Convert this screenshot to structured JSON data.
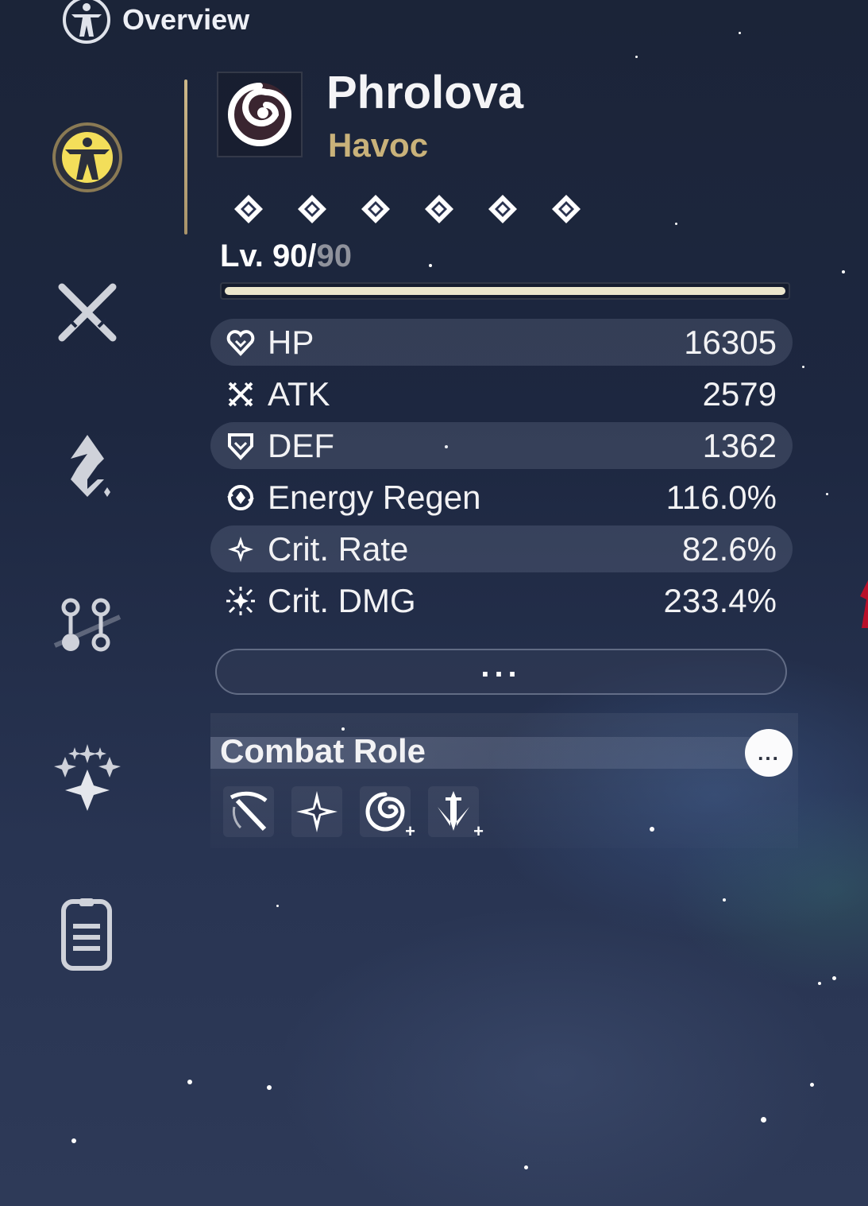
{
  "header": {
    "title": "Overview",
    "icon": "vitruvian-man-icon"
  },
  "sidebar": {
    "items": [
      {
        "name": "overview",
        "icon": "vitruvian-man-icon",
        "active": true
      },
      {
        "name": "weapon",
        "icon": "crossed-swords-icon",
        "active": false
      },
      {
        "name": "echo",
        "icon": "echo-diamond-icon",
        "active": false
      },
      {
        "name": "forte",
        "icon": "skill-tree-icon",
        "active": false
      },
      {
        "name": "resonance-chain",
        "icon": "sparkle-cluster-icon",
        "active": false
      },
      {
        "name": "profile",
        "icon": "card-document-icon",
        "active": false
      }
    ]
  },
  "character": {
    "name": "Phrolova",
    "element": "Havoc",
    "element_icon": "havoc-spiral-icon",
    "sequence_nodes": 6,
    "level": {
      "current": "Lv. 90/",
      "max": "90",
      "progress": 1.0
    }
  },
  "stats": [
    {
      "icon": "heart-icon",
      "label": "HP",
      "value": "16305"
    },
    {
      "icon": "atk-crossed-icon",
      "label": "ATK",
      "value": "2579"
    },
    {
      "icon": "shield-icon",
      "label": "DEF",
      "value": "1362"
    },
    {
      "icon": "energy-regen-icon",
      "label": "Energy Regen",
      "value": "116.0%"
    },
    {
      "icon": "crit-star-icon",
      "label": "Crit. Rate",
      "value": "82.6%"
    },
    {
      "icon": "crit-burst-icon",
      "label": "Crit. DMG",
      "value": "233.4%"
    }
  ],
  "more_button": {
    "label": "..."
  },
  "combat_role": {
    "title": "Combat Role",
    "info_button": "...",
    "icons": [
      "scythe-slash-icon",
      "four-point-star-icon",
      "spiral-plus-icon",
      "dagger-plus-icon"
    ]
  },
  "colors": {
    "accent_gold": "#c9b27a",
    "level_bar": "#ece6cc",
    "background": "#1d2740"
  }
}
